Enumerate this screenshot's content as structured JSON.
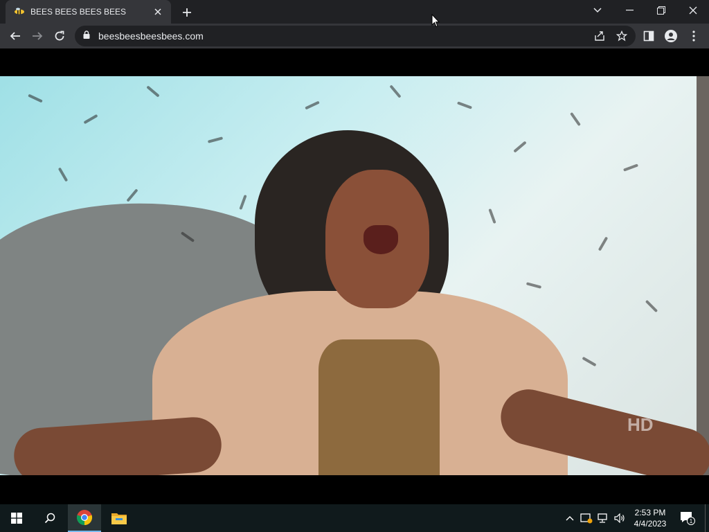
{
  "browser": {
    "tab_title": "BEES BEES BEES BEES",
    "url": "beesbeesbeesbees.com"
  },
  "content": {
    "watermark": "HD"
  },
  "taskbar": {
    "time": "2:53 PM",
    "date": "4/4/2023",
    "notification_count": "1"
  }
}
